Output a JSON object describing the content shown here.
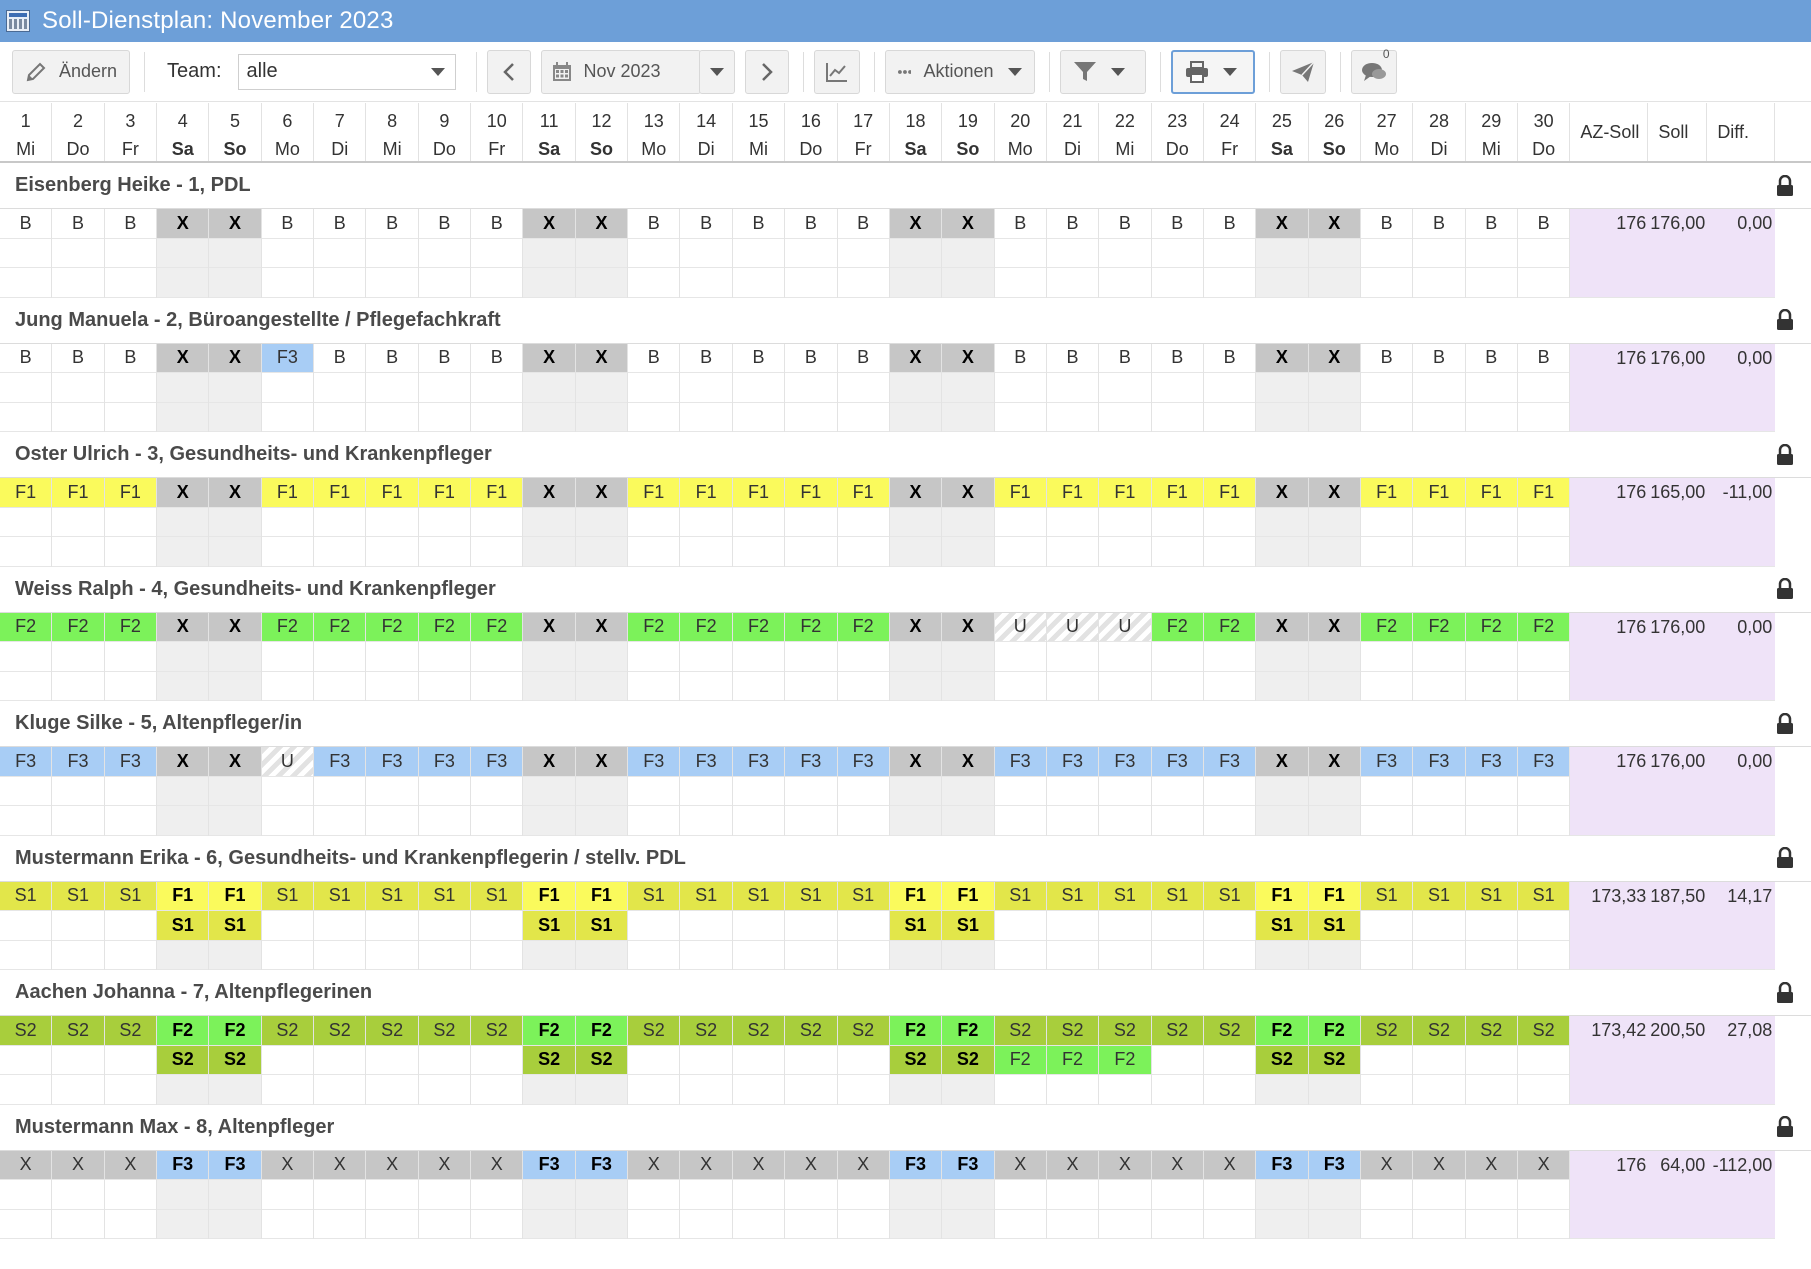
{
  "window": {
    "title": "Soll-Dienstplan: November 2023"
  },
  "toolbar": {
    "edit_label": "Ändern",
    "team_label": "Team:",
    "team_value": "alle",
    "month_value": "Nov 2023",
    "actions_label": "Aktionen",
    "chat_count": "0"
  },
  "columns": {
    "days": [
      {
        "n": "1",
        "wd": "Mi",
        "we": false
      },
      {
        "n": "2",
        "wd": "Do",
        "we": false
      },
      {
        "n": "3",
        "wd": "Fr",
        "we": false
      },
      {
        "n": "4",
        "wd": "Sa",
        "we": true
      },
      {
        "n": "5",
        "wd": "So",
        "we": true
      },
      {
        "n": "6",
        "wd": "Mo",
        "we": false
      },
      {
        "n": "7",
        "wd": "Di",
        "we": false
      },
      {
        "n": "8",
        "wd": "Mi",
        "we": false
      },
      {
        "n": "9",
        "wd": "Do",
        "we": false
      },
      {
        "n": "10",
        "wd": "Fr",
        "we": false
      },
      {
        "n": "11",
        "wd": "Sa",
        "we": true
      },
      {
        "n": "12",
        "wd": "So",
        "we": true
      },
      {
        "n": "13",
        "wd": "Mo",
        "we": false
      },
      {
        "n": "14",
        "wd": "Di",
        "we": false
      },
      {
        "n": "15",
        "wd": "Mi",
        "we": false
      },
      {
        "n": "16",
        "wd": "Do",
        "we": false
      },
      {
        "n": "17",
        "wd": "Fr",
        "we": false
      },
      {
        "n": "18",
        "wd": "Sa",
        "we": true
      },
      {
        "n": "19",
        "wd": "So",
        "we": true
      },
      {
        "n": "20",
        "wd": "Mo",
        "we": false
      },
      {
        "n": "21",
        "wd": "Di",
        "we": false
      },
      {
        "n": "22",
        "wd": "Mi",
        "we": false
      },
      {
        "n": "23",
        "wd": "Do",
        "we": false
      },
      {
        "n": "24",
        "wd": "Fr",
        "we": false
      },
      {
        "n": "25",
        "wd": "Sa",
        "we": true
      },
      {
        "n": "26",
        "wd": "So",
        "we": true
      },
      {
        "n": "27",
        "wd": "Mo",
        "we": false
      },
      {
        "n": "28",
        "wd": "Di",
        "we": false
      },
      {
        "n": "29",
        "wd": "Mi",
        "we": false
      },
      {
        "n": "30",
        "wd": "Do",
        "we": false
      }
    ],
    "az_soll": "AZ-Soll",
    "soll": "Soll",
    "diff": "Diff."
  },
  "shift_colors": {
    "B": "#ffffff",
    "X": "#c6c6c6",
    "F1": "#fafa5c",
    "F2": "#7cf25a",
    "F3": "#a8cdf5",
    "S1": "#e2e64a",
    "S2": "#a8ce3c",
    "U": "striped"
  },
  "employees": [
    {
      "name": "Eisenberg Heike - 1, PDL",
      "row1": [
        "B",
        "B",
        "B",
        "X",
        "X",
        "B",
        "B",
        "B",
        "B",
        "B",
        "X",
        "X",
        "B",
        "B",
        "B",
        "B",
        "B",
        "X",
        "X",
        "B",
        "B",
        "B",
        "B",
        "B",
        "X",
        "X",
        "B",
        "B",
        "B",
        "B"
      ],
      "row2": [
        "",
        "",
        "",
        "",
        "",
        "",
        "",
        "",
        "",
        "",
        "",
        "",
        "",
        "",
        "",
        "",
        "",
        "",
        "",
        "",
        "",
        "",
        "",
        "",
        "",
        "",
        "",
        "",
        "",
        ""
      ],
      "az_soll": "176",
      "soll": "176,00",
      "diff": "0,00"
    },
    {
      "name": "Jung Manuela - 2, Büroangestellte / Pflegefachkraft",
      "row1": [
        "B",
        "B",
        "B",
        "X",
        "X",
        "F3",
        "B",
        "B",
        "B",
        "B",
        "X",
        "X",
        "B",
        "B",
        "B",
        "B",
        "B",
        "X",
        "X",
        "B",
        "B",
        "B",
        "B",
        "B",
        "X",
        "X",
        "B",
        "B",
        "B",
        "B"
      ],
      "row2": [
        "",
        "",
        "",
        "",
        "",
        "",
        "",
        "",
        "",
        "",
        "",
        "",
        "",
        "",
        "",
        "",
        "",
        "",
        "",
        "",
        "",
        "",
        "",
        "",
        "",
        "",
        "",
        "",
        "",
        ""
      ],
      "az_soll": "176",
      "soll": "176,00",
      "diff": "0,00"
    },
    {
      "name": "Oster Ulrich - 3, Gesundheits- und Krankenpfleger",
      "row1": [
        "F1",
        "F1",
        "F1",
        "X",
        "X",
        "F1",
        "F1",
        "F1",
        "F1",
        "F1",
        "X",
        "X",
        "F1",
        "F1",
        "F1",
        "F1",
        "F1",
        "X",
        "X",
        "F1",
        "F1",
        "F1",
        "F1",
        "F1",
        "X",
        "X",
        "F1",
        "F1",
        "F1",
        "F1"
      ],
      "row2": [
        "",
        "",
        "",
        "",
        "",
        "",
        "",
        "",
        "",
        "",
        "",
        "",
        "",
        "",
        "",
        "",
        "",
        "",
        "",
        "",
        "",
        "",
        "",
        "",
        "",
        "",
        "",
        "",
        "",
        ""
      ],
      "az_soll": "176",
      "soll": "165,00",
      "diff": "-11,00"
    },
    {
      "name": "Weiss Ralph - 4, Gesundheits- und Krankenpfleger",
      "row1": [
        "F2",
        "F2",
        "F2",
        "X",
        "X",
        "F2",
        "F2",
        "F2",
        "F2",
        "F2",
        "X",
        "X",
        "F2",
        "F2",
        "F2",
        "F2",
        "F2",
        "X",
        "X",
        "U",
        "U",
        "U",
        "F2",
        "F2",
        "X",
        "X",
        "F2",
        "F2",
        "F2",
        "F2"
      ],
      "row2": [
        "",
        "",
        "",
        "",
        "",
        "",
        "",
        "",
        "",
        "",
        "",
        "",
        "",
        "",
        "",
        "",
        "",
        "",
        "",
        "",
        "",
        "",
        "",
        "",
        "",
        "",
        "",
        "",
        "",
        ""
      ],
      "az_soll": "176",
      "soll": "176,00",
      "diff": "0,00"
    },
    {
      "name": "Kluge Silke - 5, Altenpfleger/in",
      "row1": [
        "F3",
        "F3",
        "F3",
        "X",
        "X",
        "U",
        "F3",
        "F3",
        "F3",
        "F3",
        "X",
        "X",
        "F3",
        "F3",
        "F3",
        "F3",
        "F3",
        "X",
        "X",
        "F3",
        "F3",
        "F3",
        "F3",
        "F3",
        "X",
        "X",
        "F3",
        "F3",
        "F3",
        "F3"
      ],
      "row2": [
        "",
        "",
        "",
        "",
        "",
        "",
        "",
        "",
        "",
        "",
        "",
        "",
        "",
        "",
        "",
        "",
        "",
        "",
        "",
        "",
        "",
        "",
        "",
        "",
        "",
        "",
        "",
        "",
        "",
        ""
      ],
      "az_soll": "176",
      "soll": "176,00",
      "diff": "0,00"
    },
    {
      "name": "Mustermann Erika - 6, Gesundheits- und Krankenpflegerin / stellv. PDL",
      "row1": [
        "S1",
        "S1",
        "S1",
        "F1",
        "F1",
        "S1",
        "S1",
        "S1",
        "S1",
        "S1",
        "F1",
        "F1",
        "S1",
        "S1",
        "S1",
        "S1",
        "S1",
        "F1",
        "F1",
        "S1",
        "S1",
        "S1",
        "S1",
        "S1",
        "F1",
        "F1",
        "S1",
        "S1",
        "S1",
        "S1"
      ],
      "row2": [
        "",
        "",
        "",
        "S1",
        "S1",
        "",
        "",
        "",
        "",
        "",
        "S1",
        "S1",
        "",
        "",
        "",
        "",
        "",
        "S1",
        "S1",
        "",
        "",
        "",
        "",
        "",
        "S1",
        "S1",
        "",
        "",
        "",
        ""
      ],
      "az_soll": "173,33",
      "soll": "187,50",
      "diff": "14,17"
    },
    {
      "name": "Aachen Johanna - 7, Altenpflegerinen",
      "row1": [
        "S2",
        "S2",
        "S2",
        "F2",
        "F2",
        "S2",
        "S2",
        "S2",
        "S2",
        "S2",
        "F2",
        "F2",
        "S2",
        "S2",
        "S2",
        "S2",
        "S2",
        "F2",
        "F2",
        "S2",
        "S2",
        "S2",
        "S2",
        "S2",
        "F2",
        "F2",
        "S2",
        "S2",
        "S2",
        "S2"
      ],
      "row2": [
        "",
        "",
        "",
        "S2",
        "S2",
        "",
        "",
        "",
        "",
        "",
        "S2",
        "S2",
        "",
        "",
        "",
        "",
        "",
        "S2",
        "S2",
        "F2",
        "F2",
        "F2",
        "",
        "",
        "S2",
        "S2",
        "",
        "",
        "",
        ""
      ],
      "az_soll": "173,42",
      "soll": "200,50",
      "diff": "27,08"
    },
    {
      "name": "Mustermann Max - 8, Altenpfleger",
      "row1": [
        "X",
        "X",
        "X",
        "F3",
        "F3",
        "X",
        "X",
        "X",
        "X",
        "X",
        "F3",
        "F3",
        "X",
        "X",
        "X",
        "X",
        "X",
        "F3",
        "F3",
        "X",
        "X",
        "X",
        "X",
        "X",
        "F3",
        "F3",
        "X",
        "X",
        "X",
        "X"
      ],
      "row2": [
        "",
        "",
        "",
        "",
        "",
        "",
        "",
        "",
        "",
        "",
        "",
        "",
        "",
        "",
        "",
        "",
        "",
        "",
        "",
        "",
        "",
        "",
        "",
        "",
        "",
        "",
        "",
        "",
        "",
        ""
      ],
      "az_soll": "176",
      "soll": "64,00",
      "diff": "-112,00"
    }
  ]
}
